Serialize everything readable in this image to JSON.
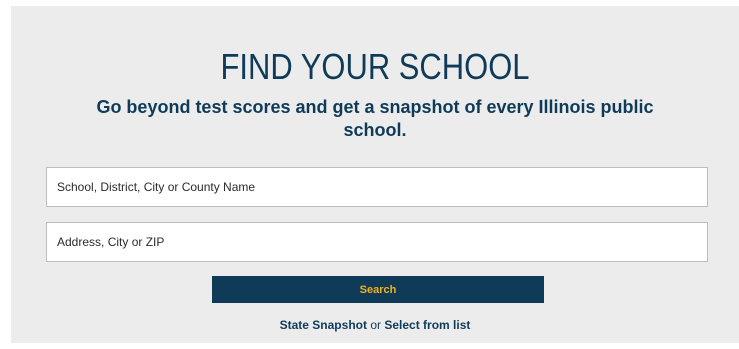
{
  "hero": {
    "title": "FIND YOUR SCHOOL",
    "subtitle": "Go beyond test scores and get a snapshot of every Illinois public school."
  },
  "search": {
    "name_placeholder": "School, District, City or County Name",
    "address_placeholder": "Address, City or ZIP",
    "button_label": "Search"
  },
  "links": {
    "state_snapshot": "State Snapshot",
    "separator": "or",
    "select_list": "Select from list"
  },
  "colors": {
    "brand_navy": "#0f3b59",
    "accent_gold": "#f2b31a",
    "panel_bg": "#ececec"
  }
}
